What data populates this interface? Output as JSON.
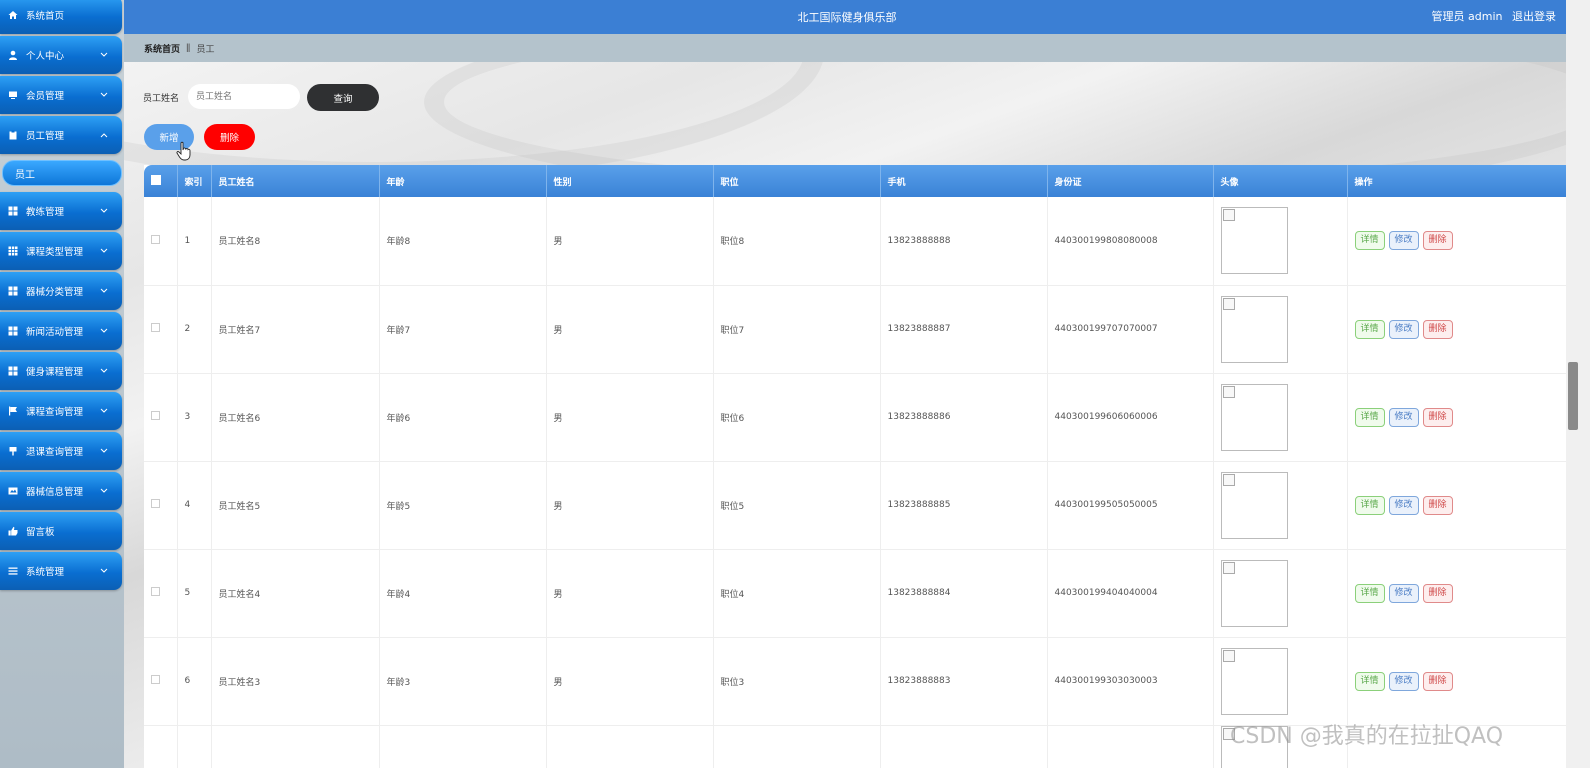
{
  "header": {
    "site_title": "北工国际健身俱乐部",
    "user_label": "管理员 admin",
    "logout": "退出登录"
  },
  "breadcrumb": {
    "home": "系统首页",
    "separator": "ǁ",
    "current": "员工"
  },
  "sidebar": {
    "items": [
      {
        "label": "系统首页",
        "icon": "home-icon",
        "arrow": false
      },
      {
        "label": "个人中心",
        "icon": "user-icon",
        "arrow": true
      },
      {
        "label": "会员管理",
        "icon": "monitor-icon",
        "arrow": true
      },
      {
        "label": "员工管理",
        "icon": "clipboard-icon",
        "arrow": true,
        "expanded": true
      },
      {
        "label": "教练管理",
        "icon": "grid-icon",
        "arrow": true
      },
      {
        "label": "课程类型管理",
        "icon": "grid-icon",
        "arrow": true
      },
      {
        "label": "器械分类管理",
        "icon": "grid-icon",
        "arrow": true
      },
      {
        "label": "新闻活动管理",
        "icon": "grid-icon",
        "arrow": true
      },
      {
        "label": "健身课程管理",
        "icon": "grid-icon",
        "arrow": true
      },
      {
        "label": "课程查询管理",
        "icon": "flag-icon",
        "arrow": true
      },
      {
        "label": "退课查询管理",
        "icon": "pin-icon",
        "arrow": true
      },
      {
        "label": "器械信息管理",
        "icon": "card-icon",
        "arrow": true
      },
      {
        "label": "留言板",
        "icon": "thumb-icon",
        "arrow": false
      },
      {
        "label": "系统管理",
        "icon": "menu-icon",
        "arrow": true
      }
    ],
    "submenu_active": "员工"
  },
  "search": {
    "label": "员工姓名",
    "placeholder": "员工姓名",
    "button": "查询"
  },
  "actions": {
    "add": "新增",
    "delete": "删除"
  },
  "table": {
    "columns": [
      "索引",
      "员工姓名",
      "年龄",
      "性别",
      "职位",
      "手机",
      "身份证",
      "头像",
      "操作"
    ],
    "rows": [
      {
        "index": "1",
        "name": "员工姓名8",
        "age": "年龄8",
        "gender": "男",
        "position": "职位8",
        "phone": "13823888888",
        "id_card": "440300199808080008"
      },
      {
        "index": "2",
        "name": "员工姓名7",
        "age": "年龄7",
        "gender": "男",
        "position": "职位7",
        "phone": "13823888887",
        "id_card": "440300199707070007"
      },
      {
        "index": "3",
        "name": "员工姓名6",
        "age": "年龄6",
        "gender": "男",
        "position": "职位6",
        "phone": "13823888886",
        "id_card": "440300199606060006"
      },
      {
        "index": "4",
        "name": "员工姓名5",
        "age": "年龄5",
        "gender": "男",
        "position": "职位5",
        "phone": "13823888885",
        "id_card": "440300199505050005"
      },
      {
        "index": "5",
        "name": "员工姓名4",
        "age": "年龄4",
        "gender": "男",
        "position": "职位4",
        "phone": "13823888884",
        "id_card": "440300199404040004"
      },
      {
        "index": "6",
        "name": "员工姓名3",
        "age": "年龄3",
        "gender": "男",
        "position": "职位3",
        "phone": "13823888883",
        "id_card": "440300199303030003"
      },
      {
        "index": "",
        "name": "",
        "age": "",
        "gender": "",
        "position": "",
        "phone": "",
        "id_card": ""
      }
    ],
    "ops": {
      "detail": "详情",
      "edit": "修改",
      "delete": "删除"
    }
  },
  "watermark": "CSDN @我真的在拉扯QAQ",
  "colors": {
    "accent": "#3b7fd4",
    "sidebar": "#0a6ed1",
    "danger": "#ff0000"
  }
}
